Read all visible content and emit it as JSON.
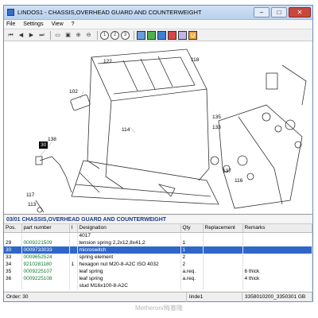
{
  "window": {
    "title": "LINDOS1 - CHASSIS,OVERHEAD GUARD AND COUNTERWEIGHT"
  },
  "menu": [
    "File",
    "Settings",
    "View",
    "?"
  ],
  "toolbar": {
    "nav_glyphs": [
      "⏮",
      "◀",
      "▶",
      "⏭"
    ],
    "circle_glyphs": [
      "1",
      "2",
      "3"
    ],
    "extra_glyphs": [
      "▭",
      "▣",
      "⊕",
      "⊖",
      "?"
    ]
  },
  "drawing": {
    "callouts": [
      "102",
      "122",
      "118",
      "135",
      "133",
      "138",
      "114",
      "117",
      "113",
      "137",
      "116"
    ],
    "highlighted_callout": "30"
  },
  "partlist": {
    "title": "03/01   CHASSIS,OVERHEAD GUARD AND COUNTERWEIGHT",
    "columns": [
      "Pos.",
      "part number",
      "I",
      "Designation",
      "Qty",
      "Replacement",
      "Remarks"
    ],
    "rows": [
      [
        "",
        "",
        "",
        "4017",
        "",
        "",
        ""
      ],
      [
        "29",
        "0009221509",
        "",
        "tension spring 2,2x12,8x41,2",
        "1",
        "",
        ""
      ],
      [
        "30",
        "0009733033",
        "",
        "microswitch",
        "1",
        "",
        ""
      ],
      [
        "33",
        "0009652524",
        "",
        "spring element",
        "2",
        "",
        ""
      ],
      [
        "34",
        "9210281180",
        "1",
        "hexagon nut M20-8-A2C  ISO 4032",
        "2",
        "",
        ""
      ],
      [
        "35",
        "0009225107",
        "",
        "leaf spring",
        "a.req.",
        "",
        "6 thick"
      ],
      [
        "36",
        "0009225108",
        "",
        "leaf spring",
        "a.req.",
        "",
        "4 thick"
      ],
      [
        "",
        "",
        "",
        "stud M16x100-8-A2C",
        "",
        "",
        ""
      ]
    ],
    "selected_index": 2
  },
  "statusbar": {
    "order": "Order: 30",
    "user": "linde1",
    "doc": "3358010200_3350301 GB",
    "lang": "GB"
  },
  "watermark": "Metheron/梅塞隆",
  "colors": {
    "selection": "#2f67c9",
    "partnumber": "#0c7a2e",
    "title": "#1a3c8c"
  }
}
